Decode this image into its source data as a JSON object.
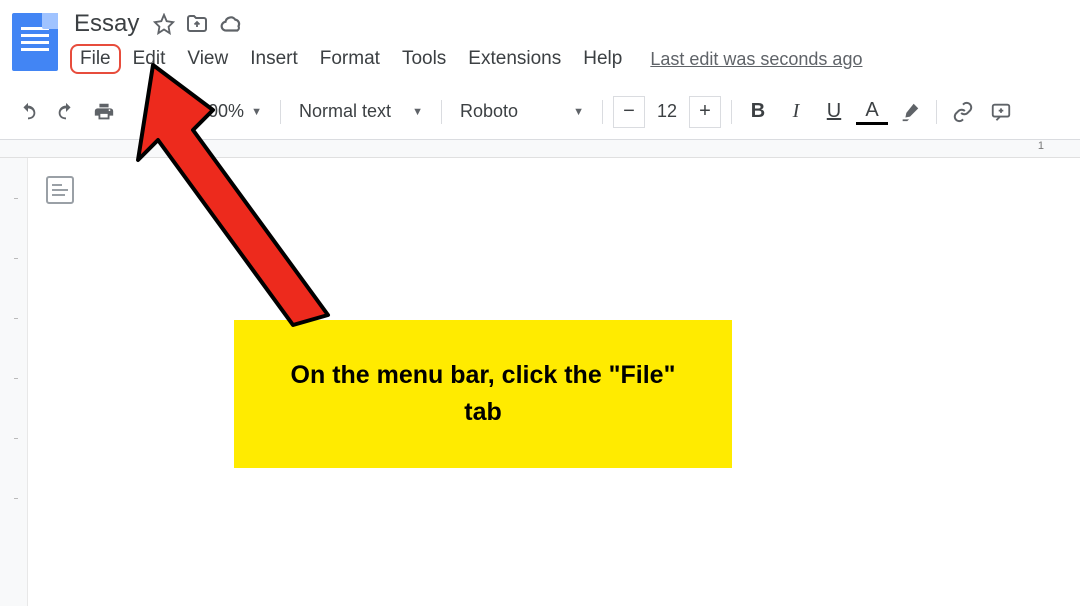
{
  "header": {
    "doc_title": "Essay"
  },
  "menubar": {
    "items": [
      "File",
      "Edit",
      "View",
      "Insert",
      "Format",
      "Tools",
      "Extensions",
      "Help"
    ],
    "last_edit": "Last edit was seconds ago",
    "highlighted_index": 0
  },
  "toolbar": {
    "zoom": "100%",
    "paragraph_style": "Normal text",
    "font": "Roboto",
    "font_size": "12",
    "decrease": "−",
    "increase": "+",
    "bold": "B",
    "italic": "I",
    "underline": "U",
    "text_color": "A"
  },
  "ruler": {
    "marker": "1"
  },
  "callout": {
    "text": "On the menu bar, click the \"File\" tab"
  }
}
